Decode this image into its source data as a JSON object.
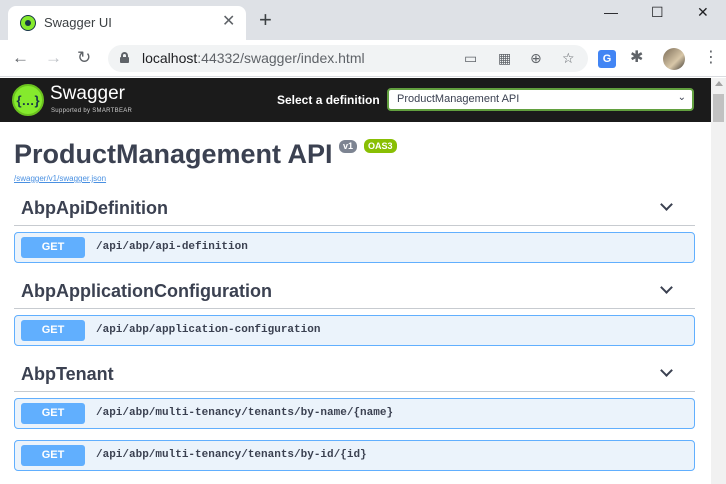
{
  "browser": {
    "tab_title": "Swagger UI",
    "tab_close": "✕",
    "new_tab": "+",
    "window_controls": {
      "minimize": "—",
      "maximize": "☐",
      "close": "✕"
    },
    "nav": {
      "back": "←",
      "forward": "→",
      "reload": "↻"
    },
    "url_host": "localhost",
    "url_rest": ":44332/swagger/index.html",
    "omnibox_icons": [
      "cast-icon",
      "qr-icon",
      "zoom-icon",
      "star-icon"
    ],
    "menu": "⋮"
  },
  "swagger_header": {
    "brand": "Swagger",
    "sub": "Supported by SMARTBEAR",
    "select_label": "Select a definition",
    "selected_definition": "ProductManagement API"
  },
  "info": {
    "title": "ProductManagement API",
    "version": "v1",
    "oas": "OAS3",
    "spec_url": "/swagger/v1/swagger.json"
  },
  "tags": [
    {
      "name": "AbpApiDefinition",
      "operations": [
        {
          "method": "GET",
          "path": "/api/abp/api-definition"
        }
      ]
    },
    {
      "name": "AbpApplicationConfiguration",
      "operations": [
        {
          "method": "GET",
          "path": "/api/abp/application-configuration"
        }
      ]
    },
    {
      "name": "AbpTenant",
      "operations": [
        {
          "method": "GET",
          "path": "/api/abp/multi-tenancy/tenants/by-name/{name}"
        },
        {
          "method": "GET",
          "path": "/api/abp/multi-tenancy/tenants/by-id/{id}"
        }
      ]
    }
  ],
  "colors": {
    "get": "#61affe",
    "get_bg": "#ebf3fb",
    "topbar": "#1b1b1b",
    "text": "#3b4151"
  }
}
